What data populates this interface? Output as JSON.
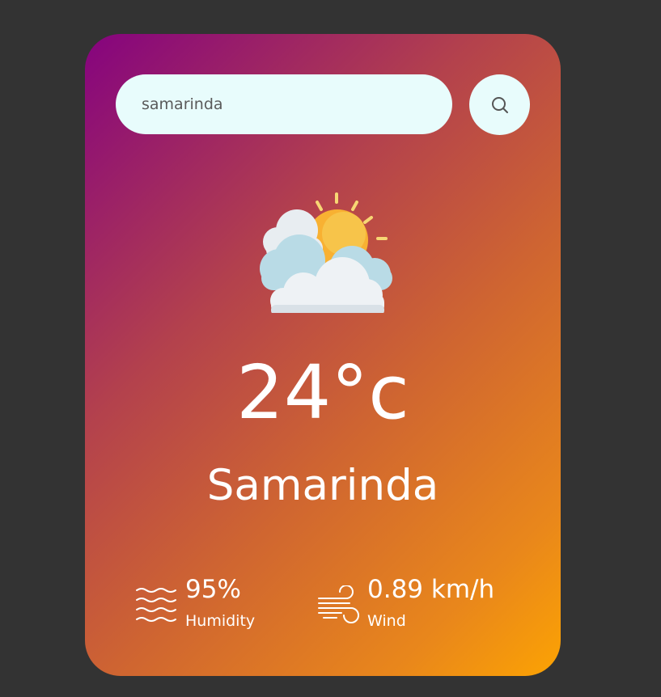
{
  "search": {
    "value": "samarinda",
    "placeholder": "",
    "button_icon": "search-icon"
  },
  "weather": {
    "icon": "partly-cloudy-icon",
    "temperature": "24°c",
    "city": "Samarinda"
  },
  "details": {
    "humidity": {
      "icon": "humidity-waves-icon",
      "value": "95%",
      "label": "Humidity"
    },
    "wind": {
      "icon": "wind-icon",
      "value": "0.89 km/h",
      "label": "Wind"
    }
  },
  "colors": {
    "background": "#333333",
    "card_gradient_start": "#85037f",
    "card_gradient_end": "#fca303",
    "field_background": "#e8fcfc",
    "text": "#ffffff"
  }
}
